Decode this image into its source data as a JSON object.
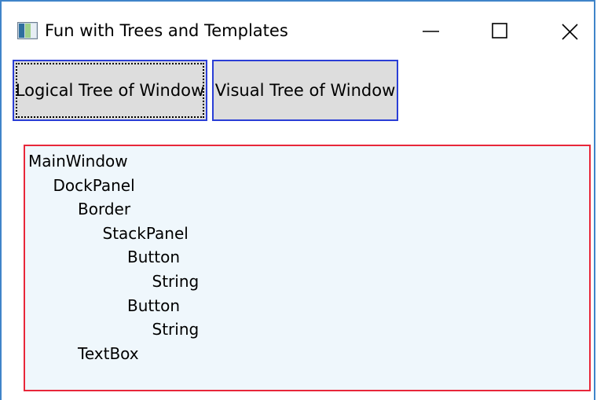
{
  "window": {
    "title": "Fun with Trees and Templates"
  },
  "icons": {
    "app": "app-window-icon",
    "minimize": "minimize-icon",
    "maximize": "maximize-icon",
    "close": "close-icon"
  },
  "buttons": {
    "logical": "Logical Tree of Window",
    "visual": "Visual Tree of Window"
  },
  "colors": {
    "button_border": "#2a3ed6",
    "textbox_border": "#e8273a",
    "textbox_background": "#eff7fc",
    "window_border": "#3f84c9"
  },
  "tree_output": {
    "lines": [
      {
        "text": "MainWindow",
        "depth": 0
      },
      {
        "text": "DockPanel",
        "depth": 1
      },
      {
        "text": "Border",
        "depth": 2
      },
      {
        "text": "StackPanel",
        "depth": 3
      },
      {
        "text": "Button",
        "depth": 4
      },
      {
        "text": "String",
        "depth": 5
      },
      {
        "text": "Button",
        "depth": 4
      },
      {
        "text": "String",
        "depth": 5
      },
      {
        "text": "TextBox",
        "depth": 2
      }
    ]
  }
}
